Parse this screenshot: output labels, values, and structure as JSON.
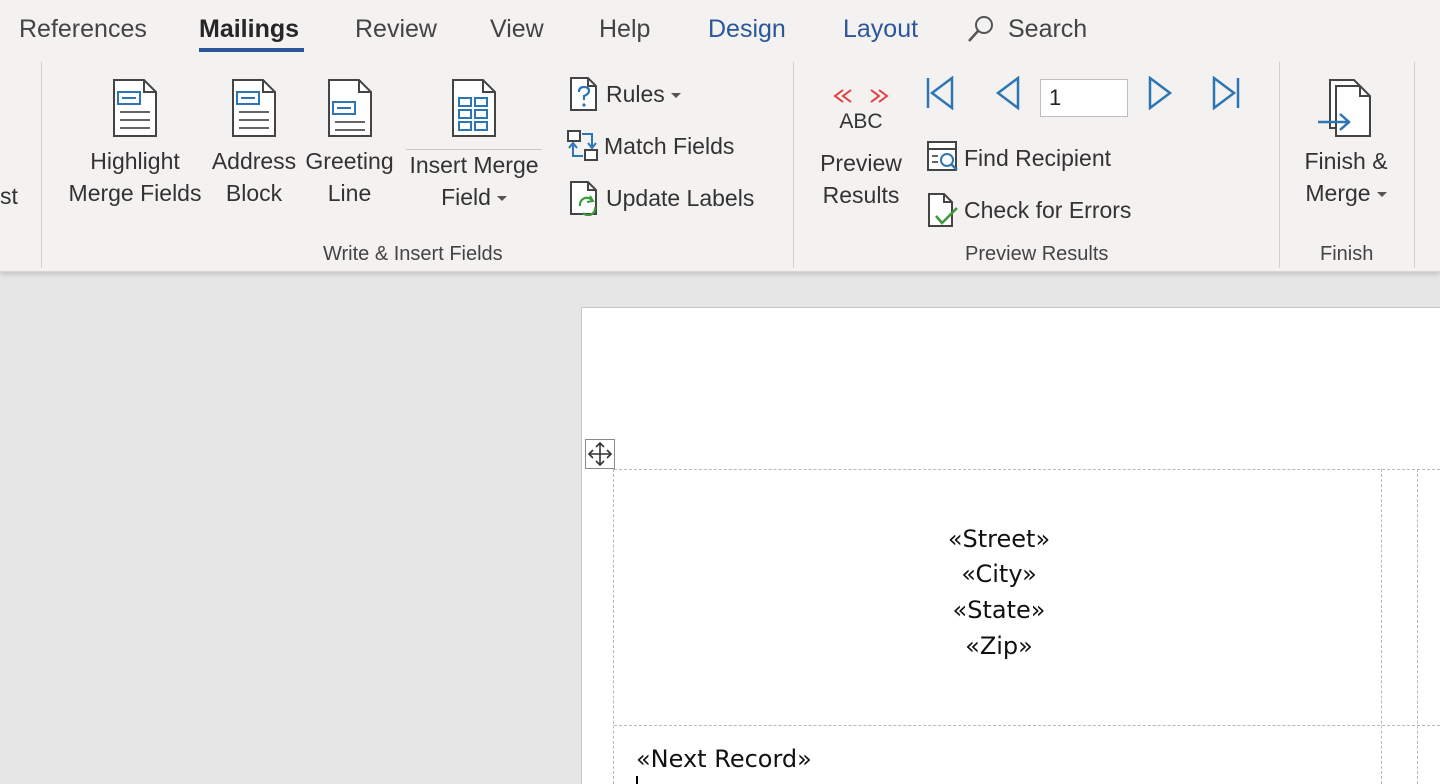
{
  "tabs": [
    {
      "label": "References"
    },
    {
      "label": "Mailings"
    },
    {
      "label": "Review"
    },
    {
      "label": "View"
    },
    {
      "label": "Help"
    },
    {
      "label": "Design"
    },
    {
      "label": "Layout"
    }
  ],
  "tell_me": {
    "label": "Search"
  },
  "ribbon": {
    "cut_off_label": "st",
    "write_insert": {
      "highlight_line1": "Highlight",
      "highlight_line2": "Merge Fields",
      "address_line1": "Address",
      "address_line2": "Block",
      "greeting_line1": "Greeting",
      "greeting_line2": "Line",
      "insert_line1": "Insert Merge",
      "insert_line2": "Field",
      "rules": "Rules",
      "match_fields": "Match Fields",
      "update_labels": "Update Labels",
      "group_label": "Write & Insert Fields"
    },
    "preview": {
      "abc": "ABC",
      "preview_line1": "Preview",
      "preview_line2": "Results",
      "record_value": "1",
      "find_recipient": "Find Recipient",
      "check_errors": "Check for Errors",
      "group_label": "Preview Results"
    },
    "finish": {
      "finish_line1": "Finish &",
      "finish_line2": "Merge",
      "group_label": "Finish"
    }
  },
  "document": {
    "fields": [
      "«Street»",
      "«City»",
      "«State»",
      "«Zip»"
    ],
    "next_record": "«Next Record»"
  },
  "colors": {
    "accent": "#2b579a",
    "icon_blue": "#2e75b6",
    "red_arrows": "#e0403c",
    "green_check": "#3c9a3c"
  }
}
